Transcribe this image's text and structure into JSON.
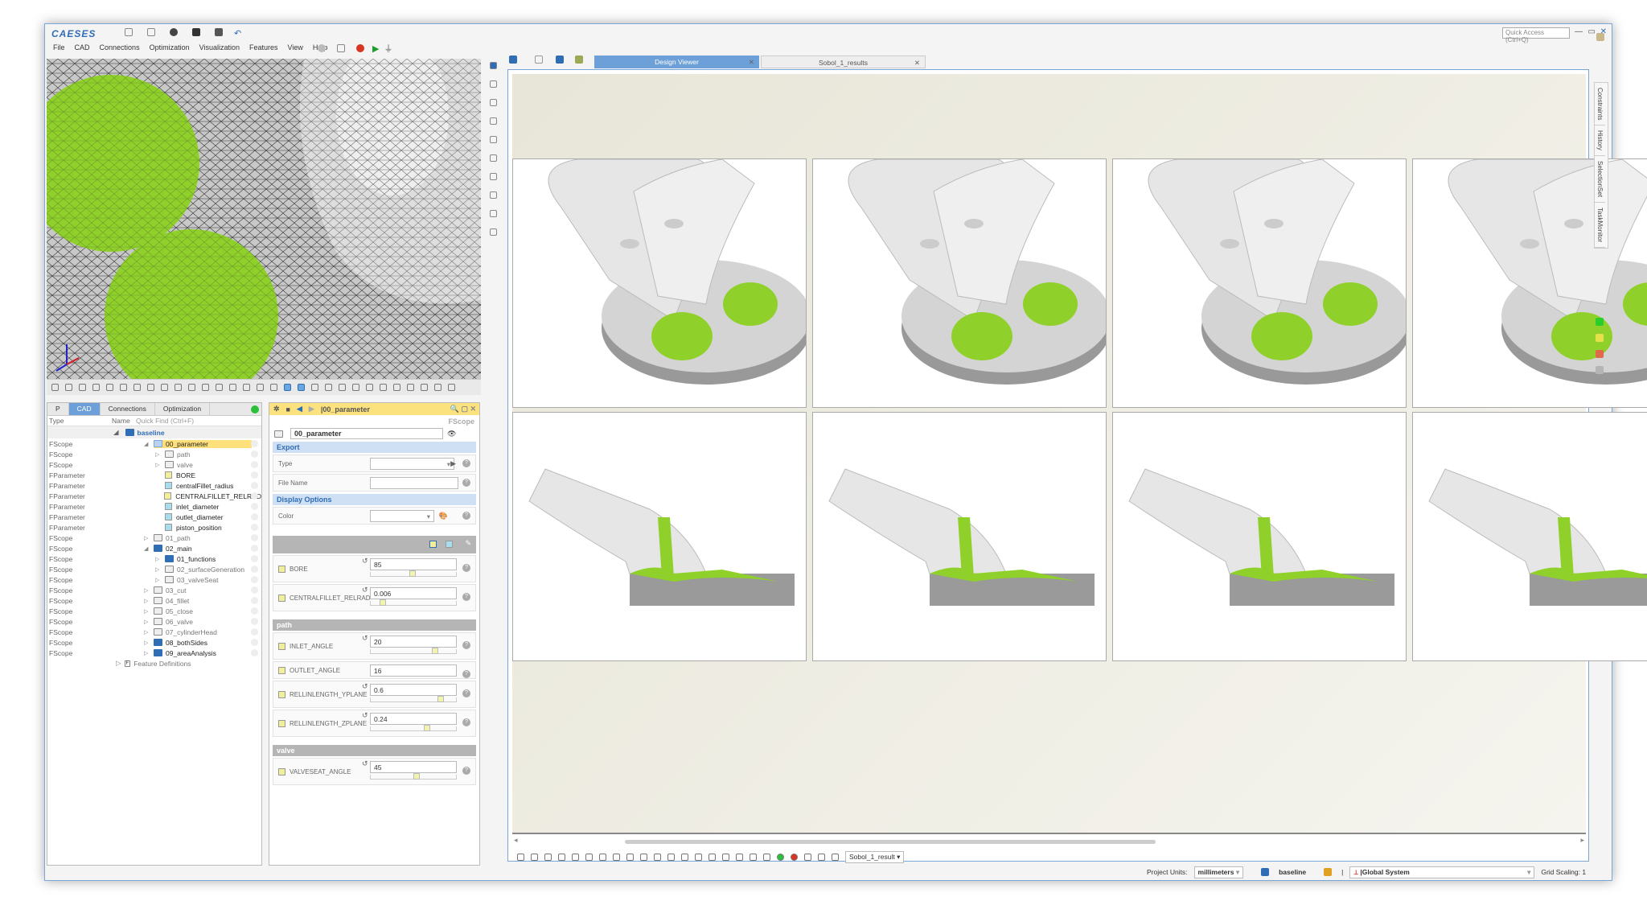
{
  "app": {
    "logo": "CAESES",
    "quick_access": "Quick Access (Ctrl+Q)"
  },
  "menu": [
    "File",
    "CAD",
    "Connections",
    "Optimization",
    "Visualization",
    "Features",
    "View",
    "Help"
  ],
  "tree": {
    "tabs": [
      "P",
      "CAD",
      "Connections",
      "Optimization"
    ],
    "headers": {
      "type": "Type",
      "name": "Name",
      "quick_find": "Quick Find (Ctrl+F)"
    },
    "root": "baseline",
    "rows": [
      {
        "type": "FScope",
        "name": "00_parameter",
        "depth": 1,
        "icon": "folder-light",
        "selected": true
      },
      {
        "type": "FScope",
        "name": "path",
        "depth": 2,
        "icon": "folder"
      },
      {
        "type": "FScope",
        "name": "valve",
        "depth": 2,
        "icon": "folder"
      },
      {
        "type": "FParameter",
        "name": "BORE",
        "depth": 2,
        "icon": "param-yellow"
      },
      {
        "type": "FParameter",
        "name": "centralFillet_radius",
        "depth": 2,
        "icon": "param-cyan"
      },
      {
        "type": "FParameter",
        "name": "CENTRALFILLET_RELRAD",
        "depth": 2,
        "icon": "param-yellow"
      },
      {
        "type": "FParameter",
        "name": "inlet_diameter",
        "depth": 2,
        "icon": "param-cyan"
      },
      {
        "type": "FParameter",
        "name": "outlet_diameter",
        "depth": 2,
        "icon": "param-cyan"
      },
      {
        "type": "FParameter",
        "name": "piston_position",
        "depth": 2,
        "icon": "param-cyan"
      },
      {
        "type": "FScope",
        "name": "01_path",
        "depth": 1,
        "icon": "folder"
      },
      {
        "type": "FScope",
        "name": "02_main",
        "depth": 1,
        "icon": "folder-blue"
      },
      {
        "type": "FScope",
        "name": "01_functions",
        "depth": 2,
        "icon": "folder-blue"
      },
      {
        "type": "FScope",
        "name": "02_surfaceGeneration",
        "depth": 2,
        "icon": "folder"
      },
      {
        "type": "FScope",
        "name": "03_valveSeat",
        "depth": 2,
        "icon": "folder"
      },
      {
        "type": "FScope",
        "name": "03_cut",
        "depth": 1,
        "icon": "folder"
      },
      {
        "type": "FScope",
        "name": "04_fillet",
        "depth": 1,
        "icon": "folder"
      },
      {
        "type": "FScope",
        "name": "05_close",
        "depth": 1,
        "icon": "folder"
      },
      {
        "type": "FScope",
        "name": "06_valve",
        "depth": 1,
        "icon": "folder"
      },
      {
        "type": "FScope",
        "name": "07_cylinderHead",
        "depth": 1,
        "icon": "folder"
      },
      {
        "type": "FScope",
        "name": "08_bothSides",
        "depth": 1,
        "icon": "folder-blue"
      },
      {
        "type": "FScope",
        "name": "09_areaAnalysis",
        "depth": 1,
        "icon": "folder-blue"
      }
    ],
    "feature_definitions": "Feature Definitions"
  },
  "props": {
    "title": "|00_parameter",
    "type_label": "FScope",
    "name_value": "00_parameter",
    "export": {
      "title": "Export",
      "type": "Type",
      "file_name": "File Name"
    },
    "display": {
      "title": "Display Options",
      "color": "Color"
    },
    "params": [
      {
        "label": "BORE",
        "value": "85",
        "pos": 0.45
      },
      {
        "label": "CENTRALFILLET_RELRAD",
        "value": "0.006",
        "pos": 0.1
      }
    ],
    "groups": [
      {
        "title": "path",
        "params": [
          {
            "label": "INLET_ANGLE",
            "value": "20",
            "pos": 0.72
          },
          {
            "label": "OUTLET_ANGLE",
            "value": "16",
            "pos": null
          },
          {
            "label": "RELLINLENGTH_YPLANE",
            "value": "0.6",
            "pos": 0.78
          },
          {
            "label": "RELLINLENGTH_ZPLANE",
            "value": "0.24",
            "pos": 0.62
          }
        ]
      },
      {
        "title": "valve",
        "params": [
          {
            "label": "VALVESEAT_ANGLE",
            "value": "45",
            "pos": 0.5
          }
        ]
      }
    ]
  },
  "viewer": {
    "tabs": [
      {
        "label": "Design Viewer",
        "active": true
      },
      {
        "label": "Sobol_1_results",
        "active": false
      }
    ],
    "bottom_dropdown": "Sobol_1_result"
  },
  "sidebar": [
    "Constraints",
    "History",
    "SelectionSet",
    "TaskMonitor"
  ],
  "status": {
    "units_label": "Project Units:",
    "units": "millimeters",
    "scope": "baseline",
    "cs_sep": "|",
    "coord_system": "|Global System",
    "grid": "Grid Scaling: 1"
  },
  "colors": {
    "accent": "#2f6db5",
    "highlight": "#ffe07a",
    "green": "#8fd12a"
  }
}
